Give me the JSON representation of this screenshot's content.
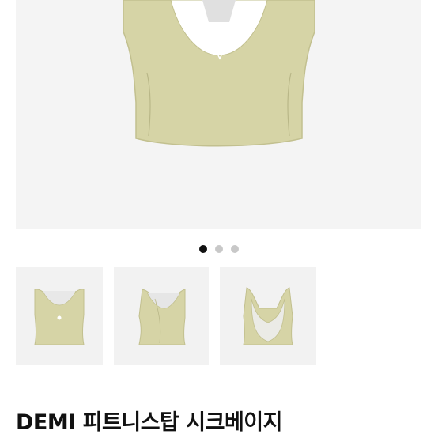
{
  "product": {
    "title": "DEMI 피트니스탑 시크베이지",
    "color_hex": "#d6d4a6"
  },
  "gallery": {
    "dot_count": 3,
    "active_index": 0,
    "thumbnails": [
      {
        "name": "thumbnail-front"
      },
      {
        "name": "thumbnail-side"
      },
      {
        "name": "thumbnail-back"
      }
    ]
  }
}
